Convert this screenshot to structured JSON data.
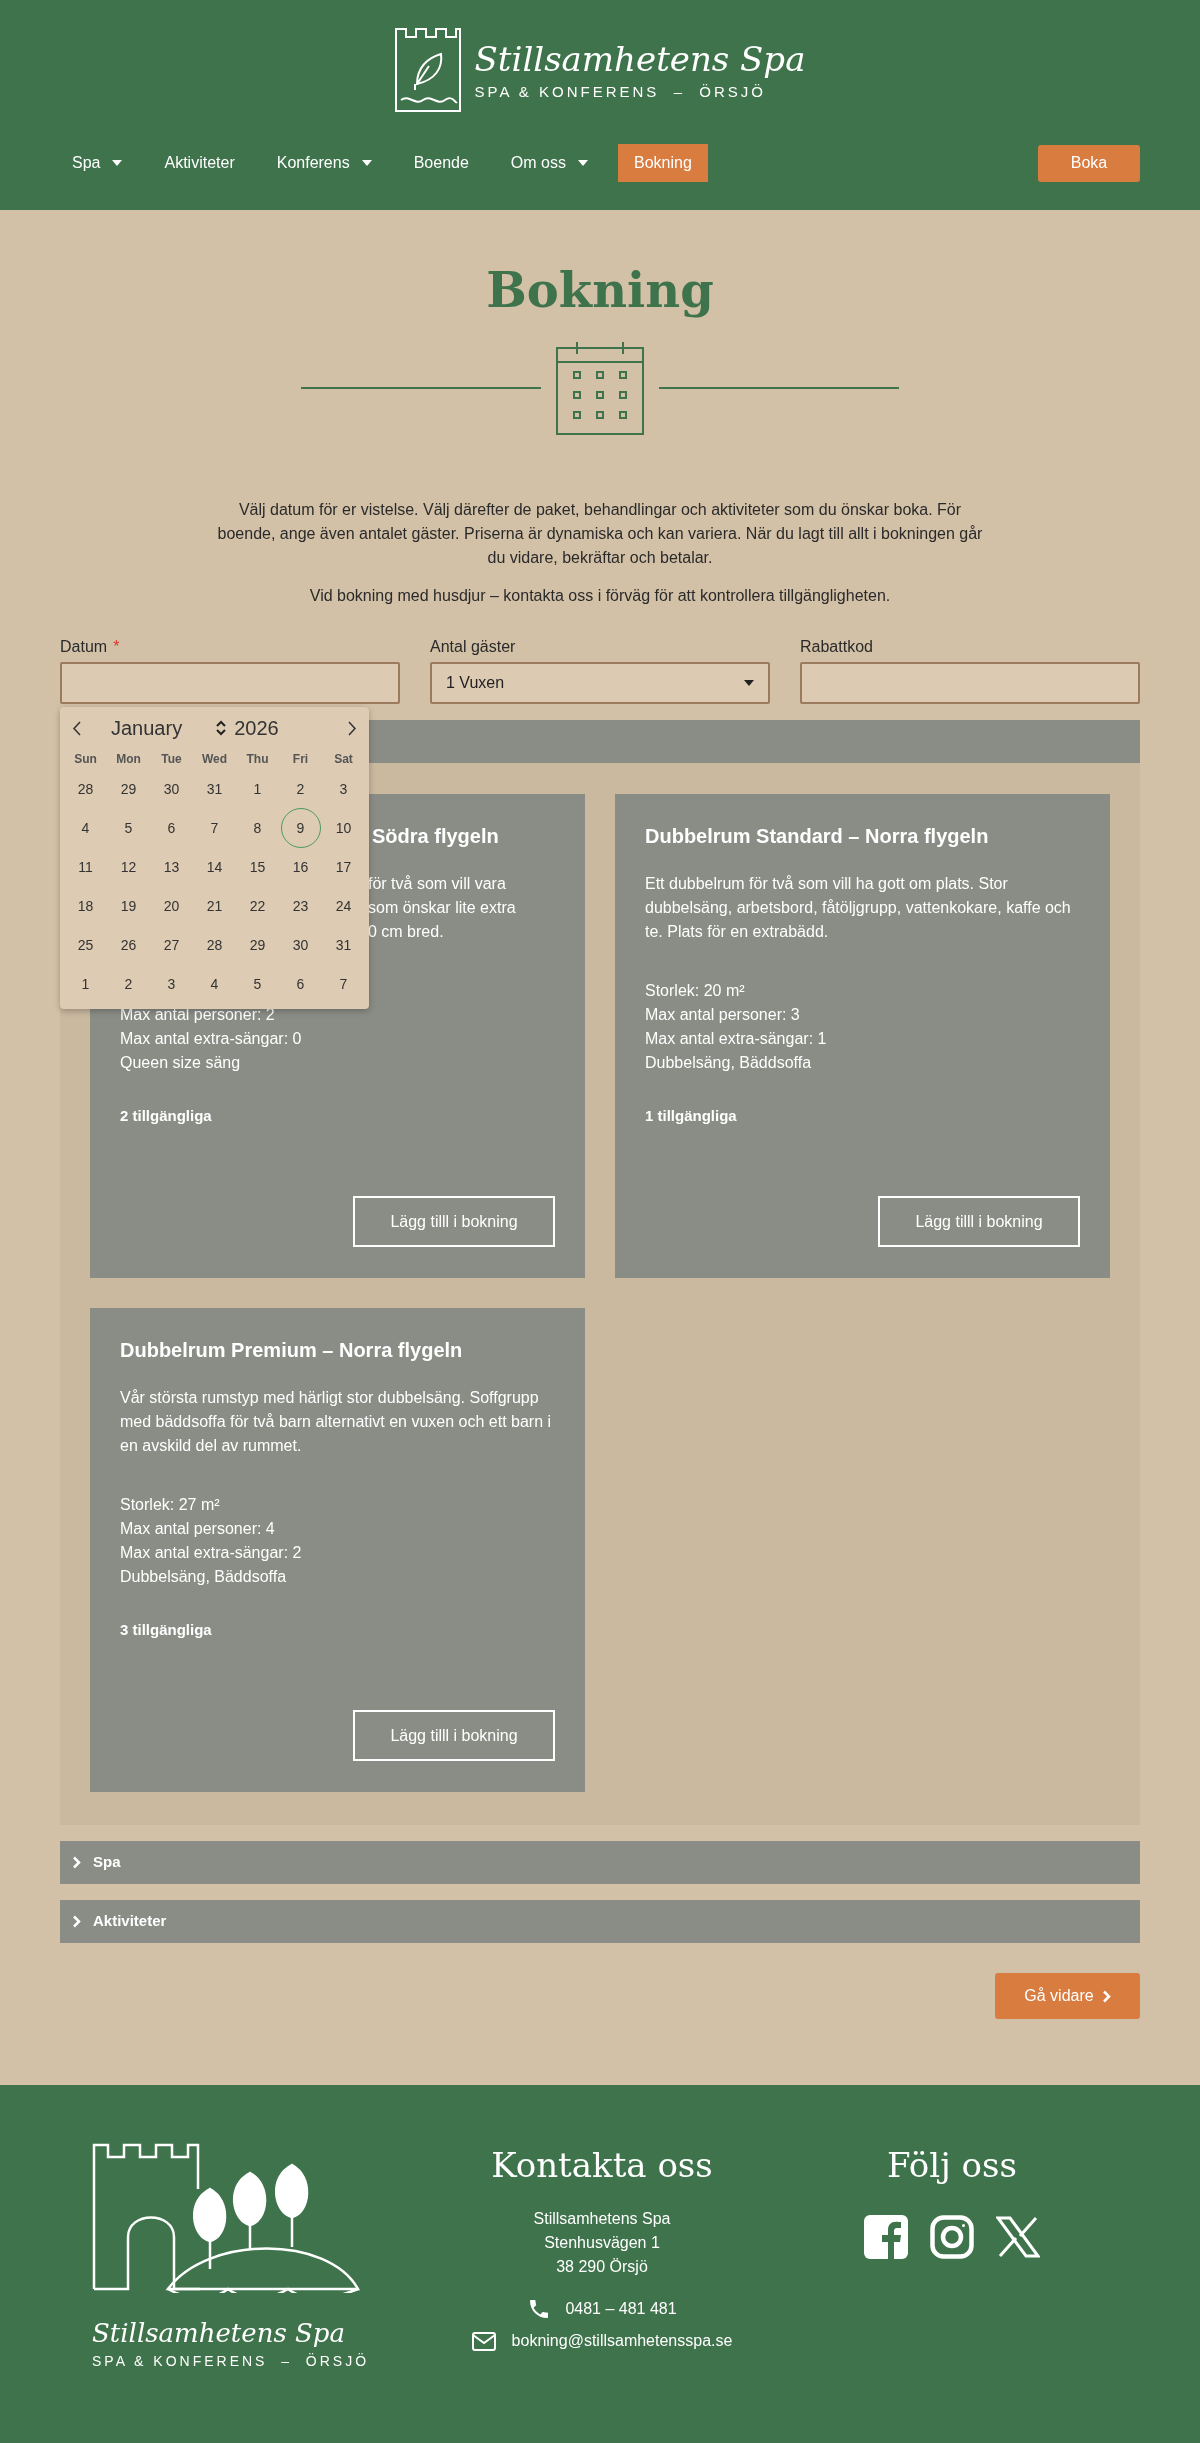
{
  "header": {
    "logo_script": "Stillsamhetens Spa",
    "logo_tagline": "SPA & KONFERENS  –  ÖRSJÖ",
    "nav": [
      {
        "label": "Spa",
        "dropdown": true,
        "selected": false
      },
      {
        "label": "Aktiviteter",
        "dropdown": false,
        "selected": false
      },
      {
        "label": "Konferens",
        "dropdown": true,
        "selected": false
      },
      {
        "label": "Boende",
        "dropdown": false,
        "selected": false
      },
      {
        "label": "Om oss",
        "dropdown": true,
        "selected": false
      },
      {
        "label": "Bokning",
        "dropdown": false,
        "selected": true
      }
    ],
    "cta": "Boka"
  },
  "page_title": "Bokning",
  "intro": [
    "Välj datum för er vistelse. Välj därefter de paket, behandlingar och aktiviteter som du önskar boka. För boende, ange även antalet gäster. Priserna är dynamiska och kan variera. När du lagt till allt i bokningen går du vidare, bekräftar och betalar.",
    "Vid bokning med husdjur – kontakta oss i förväg för att kontrollera tillgängligheten."
  ],
  "form": [
    {
      "kind": "date",
      "label": "Datum",
      "marker": "*"
    },
    {
      "kind": "select",
      "label": "Antal gäster",
      "value": "1 Vuxen"
    },
    {
      "kind": "text",
      "label": "Rabattkod"
    }
  ],
  "datepicker": {
    "open": true,
    "month": "January",
    "year": "2026",
    "weekdays": [
      "Sun",
      "Mon",
      "Tue",
      "Wed",
      "Thu",
      "Fri",
      "Sat"
    ],
    "weeks": [
      [
        {
          "day": "28",
          "selected": false
        },
        {
          "day": "29",
          "selected": false
        },
        {
          "day": "30",
          "selected": false
        },
        {
          "day": "31",
          "selected": false
        },
        {
          "day": "1",
          "selected": false
        },
        {
          "day": "2",
          "selected": false
        },
        {
          "day": "3",
          "selected": false
        }
      ],
      [
        {
          "day": "4",
          "selected": false
        },
        {
          "day": "5",
          "selected": false
        },
        {
          "day": "6",
          "selected": false
        },
        {
          "day": "7",
          "selected": false
        },
        {
          "day": "8",
          "selected": false
        },
        {
          "day": "9",
          "selected": true
        },
        {
          "day": "10",
          "selected": false
        }
      ],
      [
        {
          "day": "11",
          "selected": false
        },
        {
          "day": "12",
          "selected": false
        },
        {
          "day": "13",
          "selected": false
        },
        {
          "day": "14",
          "selected": false
        },
        {
          "day": "15",
          "selected": false
        },
        {
          "day": "16",
          "selected": false
        },
        {
          "day": "17",
          "selected": false
        }
      ],
      [
        {
          "day": "18",
          "selected": false
        },
        {
          "day": "19",
          "selected": false
        },
        {
          "day": "20",
          "selected": false
        },
        {
          "day": "21",
          "selected": false
        },
        {
          "day": "22",
          "selected": false
        },
        {
          "day": "23",
          "selected": false
        },
        {
          "day": "24",
          "selected": false
        }
      ],
      [
        {
          "day": "25",
          "selected": false
        },
        {
          "day": "26",
          "selected": false
        },
        {
          "day": "27",
          "selected": false
        },
        {
          "day": "28",
          "selected": false
        },
        {
          "day": "29",
          "selected": false
        },
        {
          "day": "30",
          "selected": false
        },
        {
          "day": "31",
          "selected": false
        }
      ],
      [
        {
          "day": "1",
          "selected": false
        },
        {
          "day": "2",
          "selected": false
        },
        {
          "day": "3",
          "selected": false
        },
        {
          "day": "4",
          "selected": false
        },
        {
          "day": "5",
          "selected": false
        },
        {
          "day": "6",
          "selected": false
        },
        {
          "day": "7",
          "selected": false
        }
      ]
    ]
  },
  "sections": [
    {
      "expanded": true,
      "cards": [
        {
          "covered": true,
          "title": "Södra flygeln",
          "description": [
            "för två som vill vara",
            "som önskar lite extra",
            "0 cm bred."
          ],
          "specs": [
            "Max antal personer: 2",
            "Max antal extra-sängar: 0",
            "Queen size säng"
          ],
          "availability": "2 tillgängliga",
          "button": "Lägg tilll i bokning"
        },
        {
          "covered": false,
          "title": "Dubbelrum Standard – Norra flygeln",
          "description": "Ett dubbelrum för två som vill ha gott om plats. Stor dubbelsäng, arbetsbord, fåtöljgrupp, vattenkokare, kaffe och te. Plats för en extrabädd.",
          "specs": [
            "Storlek: 20 m²",
            "Max antal personer: 3",
            "Max antal extra-sängar: 1",
            "Dubbelsäng, Bäddsoffa"
          ],
          "availability": "1 tillgängliga",
          "button": "Lägg tilll i bokning"
        },
        {
          "covered": false,
          "title": "Dubbelrum Premium – Norra flygeln",
          "description": "Vår största rumstyp med härligt stor dubbelsäng. Soffgrupp med bäddsoffa för två barn alternativt en vuxen och ett barn i en avskild del av rummet.",
          "specs": [
            "Storlek: 27 m²",
            "Max antal personer: 4",
            "Max antal extra-sängar: 2",
            "Dubbelsäng, Bäddsoffa"
          ],
          "availability": "3 tillgängliga",
          "button": "Lägg tilll i bokning"
        }
      ]
    },
    {
      "label": "Spa",
      "expanded": false
    },
    {
      "label": "Aktiviteter",
      "expanded": false
    }
  ],
  "next_button": "Gå vidare",
  "footer": {
    "logo_script": "Stillsamhetens Spa",
    "logo_tagline": "SPA & KONFERENS  –  ÖRSJÖ",
    "contact_title": "Kontakta oss",
    "address": [
      "Stillsamhetens Spa",
      "Stenhusvägen 1",
      "38 290 Örsjö"
    ],
    "phone": "0481 – 481 481",
    "email": "bokning@stillsamhetensspa.se",
    "follow_title": "Följ oss"
  }
}
